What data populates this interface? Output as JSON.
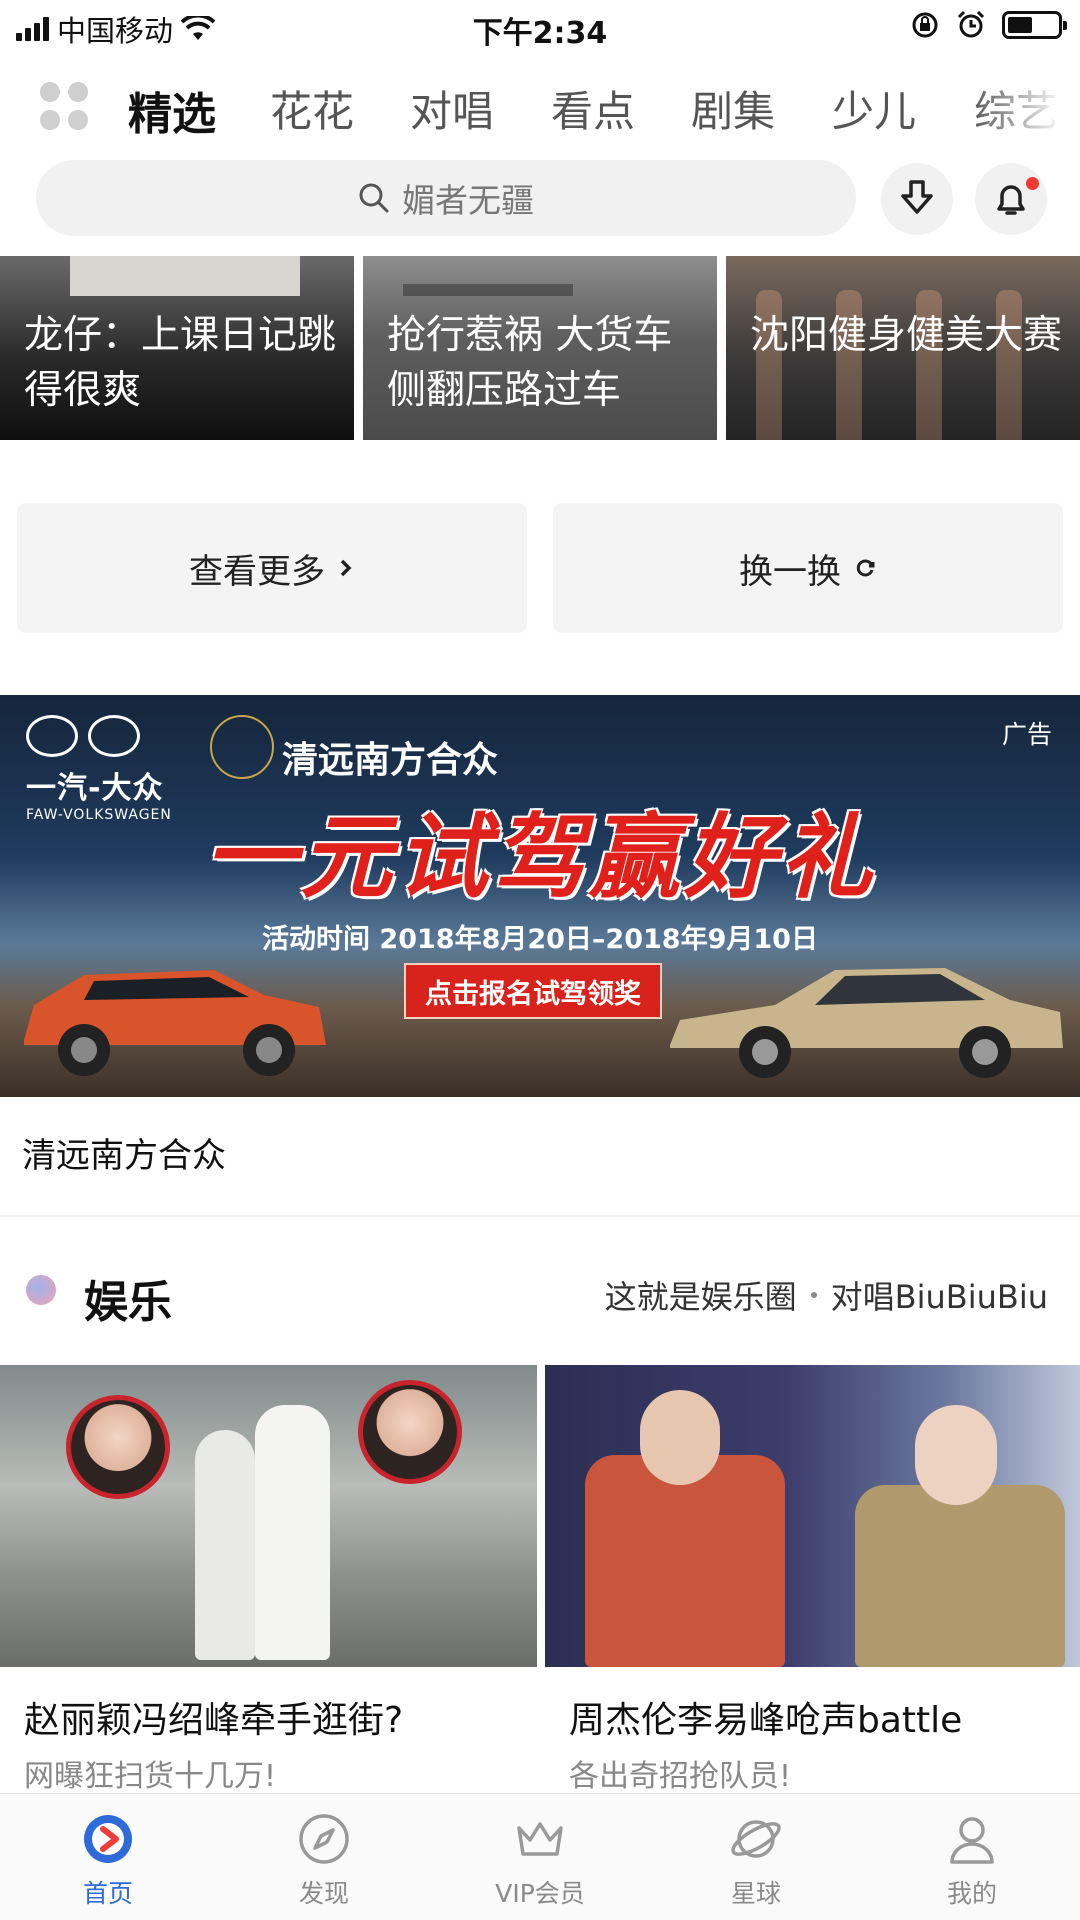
{
  "status_bar": {
    "carrier": "中国移动",
    "time": "下午2:34",
    "battery_level": 0.5
  },
  "channel_tabs": [
    "精选",
    "花花",
    "对唱",
    "看点",
    "剧集",
    "少儿",
    "综艺"
  ],
  "active_tab": "精选",
  "search": {
    "placeholder": "媚者无疆"
  },
  "video_cards": [
    {
      "title": "龙仔：上课日记跳得很爽"
    },
    {
      "title": "抢行惹祸 大货车侧翻压路过车"
    },
    {
      "title": "沈阳健身健美大赛"
    }
  ],
  "buttons": {
    "more": "查看更多",
    "refresh": "换一换"
  },
  "ad": {
    "brand_cn": "一汽-大众",
    "brand_en": "FAW-VOLKSWAGEN",
    "dealer": "清远南方合众",
    "tag": "广告",
    "headline": "一元试驾赢好礼",
    "period": "活动时间 2018年8月20日–2018年9月10日",
    "cta": "点击报名试驾领奖",
    "caption": "清远南方合众"
  },
  "entertainment": {
    "title": "娱乐",
    "links": [
      "这就是娱乐圈",
      "对唱BiuBiuBiu"
    ],
    "cards": [
      {
        "title": "赵丽颖冯绍峰牵手逛街?",
        "subtitle": "网曝狂扫货十几万!"
      },
      {
        "title": "周杰伦李易峰呛声battle",
        "subtitle": "各出奇招抢队员!"
      }
    ]
  },
  "bottom_nav": [
    {
      "label": "首页",
      "icon": "home-play-icon",
      "active": true
    },
    {
      "label": "发现",
      "icon": "compass-icon",
      "active": false
    },
    {
      "label": "VIP会员",
      "icon": "crown-icon",
      "active": false
    },
    {
      "label": "星球",
      "icon": "planet-icon",
      "active": false
    },
    {
      "label": "我的",
      "icon": "profile-icon",
      "active": false
    }
  ],
  "colors": {
    "accent_blue": "#2f6bd8",
    "ad_red": "#e0201b",
    "notification_dot": "#f2382f"
  }
}
